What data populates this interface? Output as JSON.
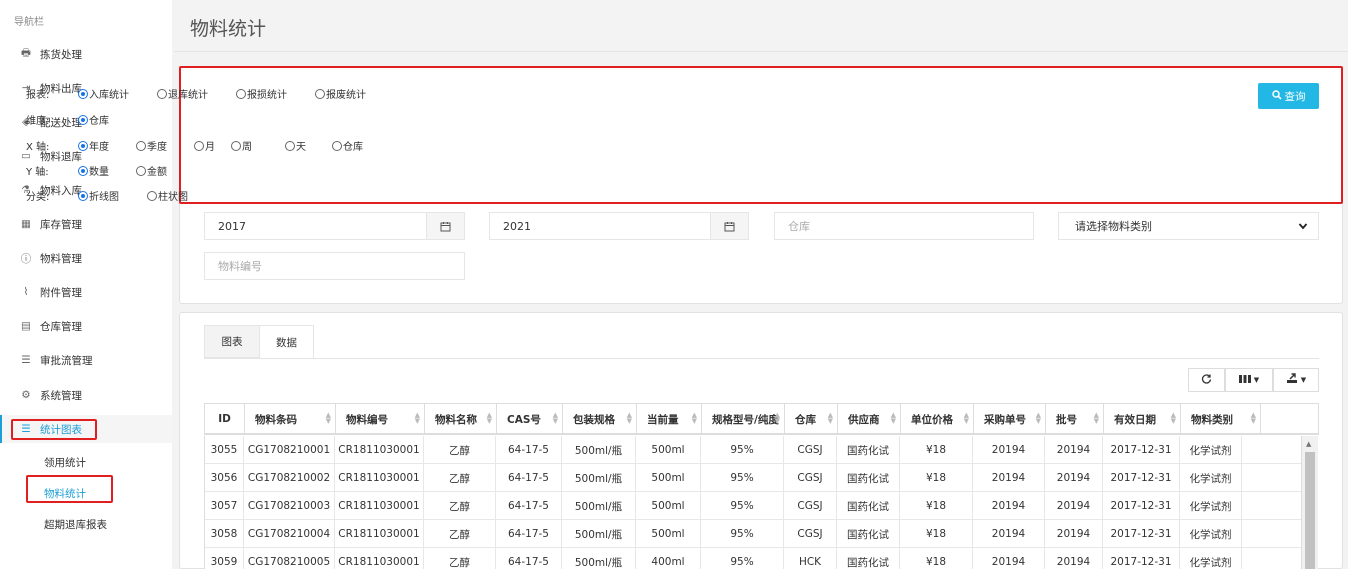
{
  "sidebar": {
    "header": "导航栏",
    "items": [
      {
        "label": "拣货处理",
        "icon": "printer-icon",
        "glyph": "🖶"
      },
      {
        "label": "物料出库",
        "icon": "sign-out-icon",
        "glyph": "⇥"
      },
      {
        "label": "配送处理",
        "icon": "layers-icon",
        "glyph": "◈"
      },
      {
        "label": "物料退库",
        "icon": "monitor-icon",
        "glyph": "▭"
      },
      {
        "label": "物料入库",
        "icon": "flask-icon",
        "glyph": "⚗"
      },
      {
        "label": "库存管理",
        "icon": "grid-icon",
        "glyph": "▦"
      },
      {
        "label": "物料管理",
        "icon": "info-icon",
        "glyph": "ⓘ"
      },
      {
        "label": "附件管理",
        "icon": "paperclip-icon",
        "glyph": "⌇"
      },
      {
        "label": "仓库管理",
        "icon": "book-icon",
        "glyph": "▤"
      },
      {
        "label": "审批流管理",
        "icon": "list-icon",
        "glyph": "☰"
      },
      {
        "label": "系统管理",
        "icon": "gear-icon",
        "glyph": "⚙"
      },
      {
        "label": "统计图表",
        "icon": "list-icon",
        "glyph": "☰"
      }
    ],
    "subitems": [
      "领用统计",
      "物料统计",
      "超期退库报表"
    ]
  },
  "page": {
    "title": "物料统计"
  },
  "filters": {
    "report": {
      "label": "报表:",
      "options": [
        "入库统计",
        "退库统计",
        "报损统计",
        "报废统计"
      ],
      "selected": 0
    },
    "dimension": {
      "label": "维度:",
      "options": [
        "仓库"
      ],
      "selected": 0
    },
    "xaxis": {
      "label": "X 轴:",
      "options": [
        "年度",
        "季度",
        "月",
        "周",
        "天",
        "仓库"
      ],
      "selected": 0
    },
    "yaxis": {
      "label": "Y 轴:",
      "options": [
        "数量",
        "金额"
      ],
      "selected": 0
    },
    "category": {
      "label": "分类:",
      "options": [
        "折线图",
        "柱状图"
      ],
      "selected": 0
    },
    "query_label": "查询"
  },
  "inputs": {
    "start_year": "2017",
    "end_year": "2021",
    "warehouse_placeholder": "仓库",
    "material_type_select": "请选择物料类别",
    "material_code_placeholder": "物料编号"
  },
  "tabs": [
    "图表",
    "数据"
  ],
  "table": {
    "headers": [
      "ID",
      "物料条码",
      "物料编号",
      "物料名称",
      "CAS号",
      "包装规格",
      "当前量",
      "规格型号/纯度",
      "仓库",
      "供应商",
      "单位价格",
      "采购单号",
      "批号",
      "有效日期",
      "物料类别"
    ],
    "rows": [
      [
        "3055",
        "CG1708210001",
        "CR1811030001",
        "乙醇",
        "64-17-5",
        "500ml/瓶",
        "500ml",
        "95%",
        "CGSJ",
        "国药化试",
        "¥18",
        "20194",
        "20194",
        "2017-12-31",
        "化学试剂"
      ],
      [
        "3056",
        "CG1708210002",
        "CR1811030001",
        "乙醇",
        "64-17-5",
        "500ml/瓶",
        "500ml",
        "95%",
        "CGSJ",
        "国药化试",
        "¥18",
        "20194",
        "20194",
        "2017-12-31",
        "化学试剂"
      ],
      [
        "3057",
        "CG1708210003",
        "CR1811030001",
        "乙醇",
        "64-17-5",
        "500ml/瓶",
        "500ml",
        "95%",
        "CGSJ",
        "国药化试",
        "¥18",
        "20194",
        "20194",
        "2017-12-31",
        "化学试剂"
      ],
      [
        "3058",
        "CG1708210004",
        "CR1811030001",
        "乙醇",
        "64-17-5",
        "500ml/瓶",
        "500ml",
        "95%",
        "CGSJ",
        "国药化试",
        "¥18",
        "20194",
        "20194",
        "2017-12-31",
        "化学试剂"
      ],
      [
        "3059",
        "CG1708210005",
        "CR1811030001",
        "乙醇",
        "64-17-5",
        "500ml/瓶",
        "400ml",
        "95%",
        "HCK",
        "国药化试",
        "¥18",
        "20194",
        "20194",
        "2017-12-31",
        "化学试剂"
      ]
    ]
  },
  "colors": {
    "accent": "#1d9fd8",
    "button": "#23b7e5",
    "highlight": "#e02020"
  }
}
